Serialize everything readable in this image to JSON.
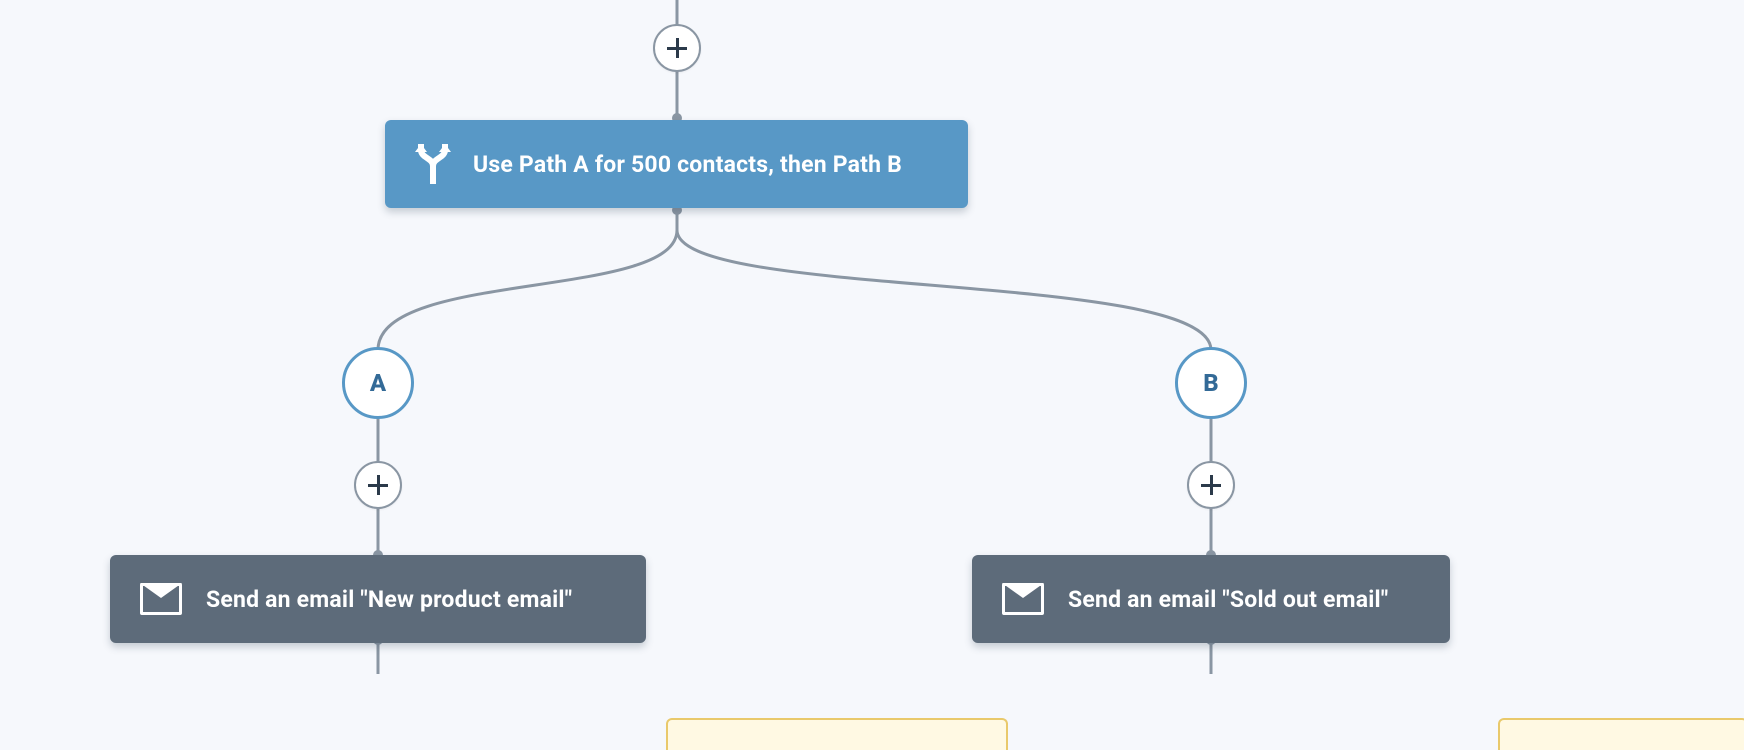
{
  "split": {
    "label": "Use Path A for 500 contacts, then Path B"
  },
  "paths": {
    "a": {
      "badge": "A",
      "action_prefix": "Send an email ",
      "action_name": "\"New product email\""
    },
    "b": {
      "badge": "B",
      "action_prefix": "Send an email ",
      "action_name": "\"Sold out email\""
    }
  }
}
